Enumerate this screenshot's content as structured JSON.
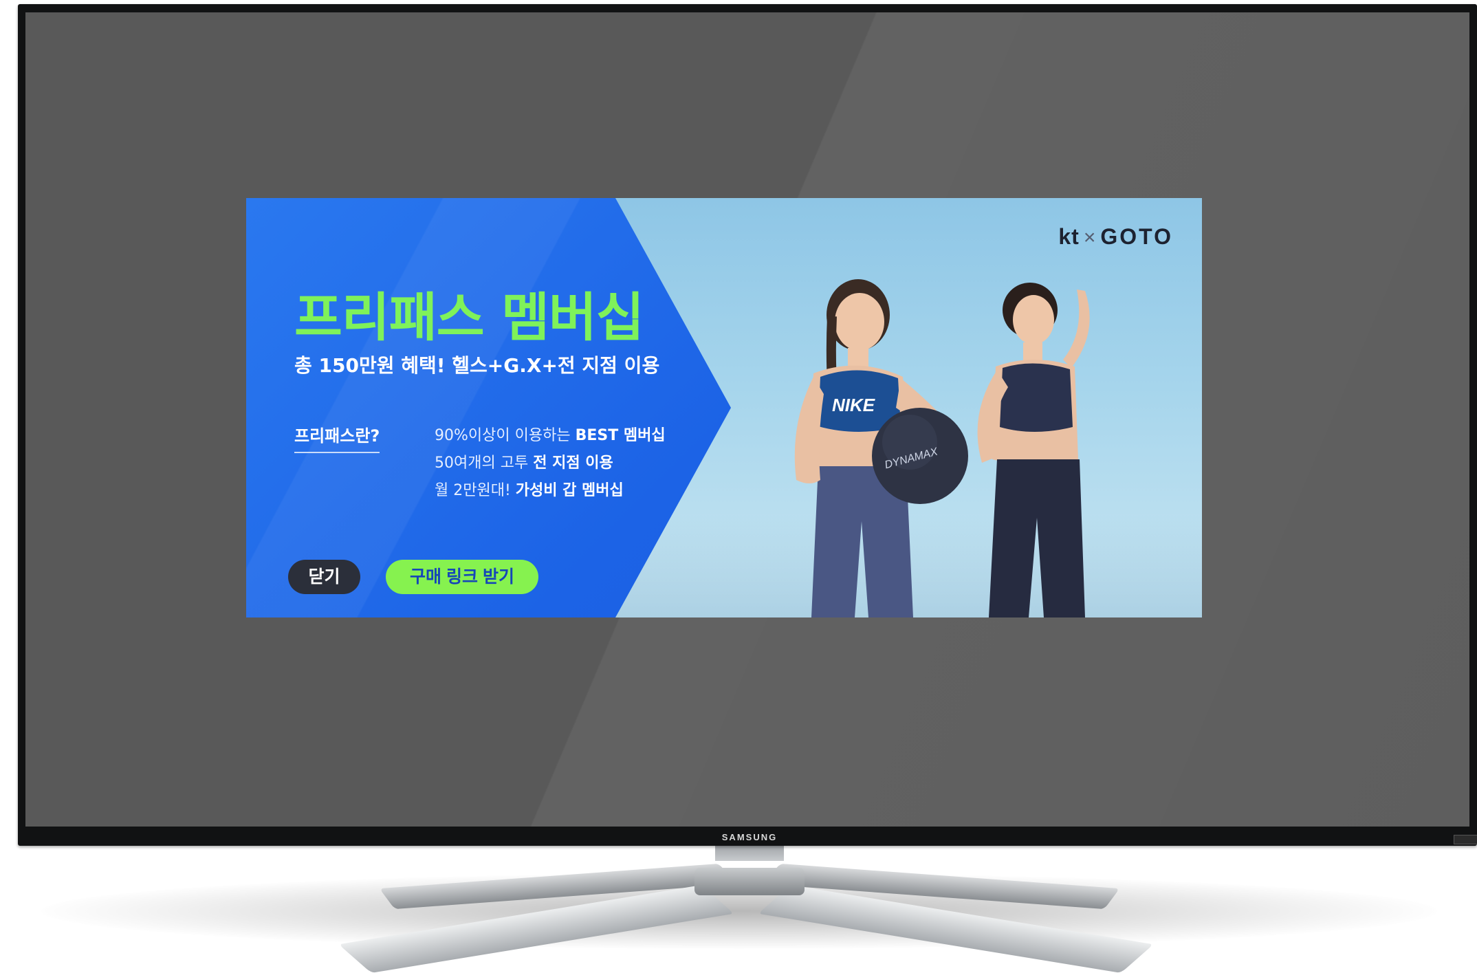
{
  "tv": {
    "brand": "SAMSUNG"
  },
  "banner": {
    "logo": {
      "left": "kt",
      "separator": "×",
      "right": "GOTO"
    },
    "title": "프리패스 멤버십",
    "subtitle": "총 150만원 혜택! 헬스+G.X+전 지점 이용",
    "what_label": "프리패스란?",
    "features": [
      {
        "plain": "90%이상이 이용하는 ",
        "bold": "BEST 멤버십"
      },
      {
        "plain": "50여개의 고투 ",
        "bold": "전 지점 이용"
      },
      {
        "plain": "월 2만원대! ",
        "bold": "가성비 갑 멤버십"
      }
    ],
    "buttons": {
      "close_label": "닫기",
      "buy_label": "구매 링크 받기"
    },
    "photo_text": {
      "bra_logo": "NIKE",
      "ball_logo": "DYNAMAX"
    }
  },
  "colors": {
    "panel_blue": "#1c63e6",
    "title_green": "#7ff25a",
    "buy_button": "#86f24f",
    "close_button": "#2b2f3a",
    "screen_gray": "#595959"
  }
}
